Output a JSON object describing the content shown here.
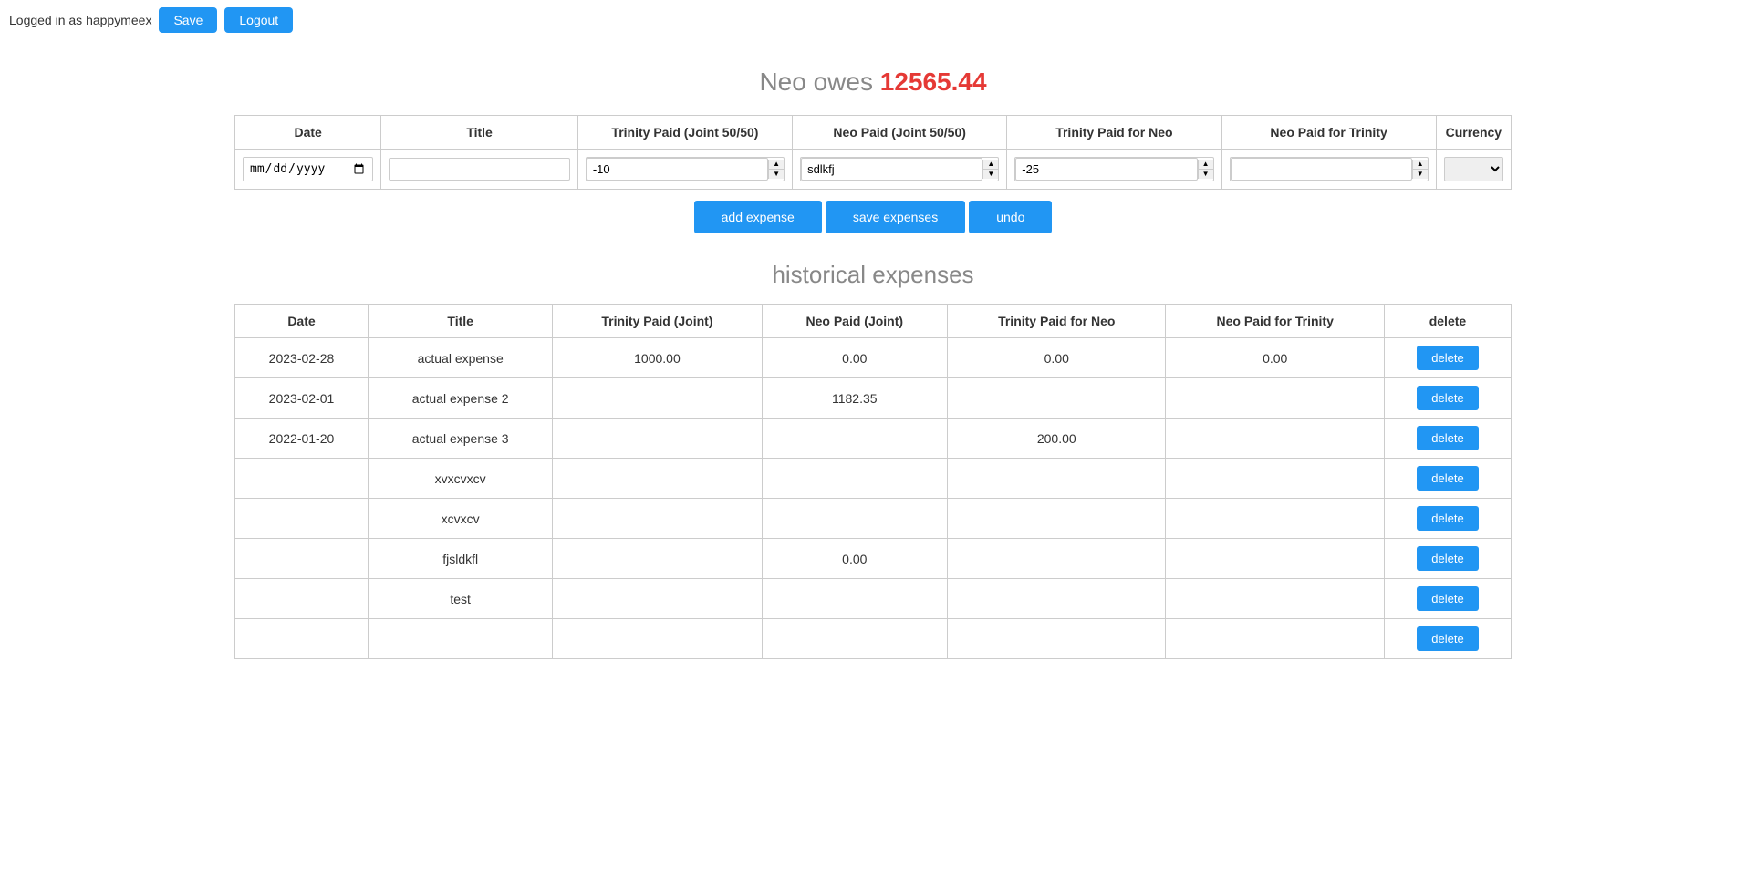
{
  "topbar": {
    "logged_in_text": "Logged in as happymeex",
    "save_label": "Save",
    "logout_label": "Logout"
  },
  "main_heading": {
    "text": "Neo owes",
    "amount": "12565.44"
  },
  "input_form": {
    "columns": [
      "Date",
      "Title",
      "Trinity Paid (Joint 50/50)",
      "Neo Paid (Joint 50/50)",
      "Trinity Paid for Neo",
      "Neo Paid for Trinity",
      "Currency"
    ],
    "date_placeholder": "mm / dd / yyyy",
    "title_value": "",
    "trinity_joint_value": "-10",
    "neo_joint_value": "sdlkfj",
    "trinity_for_neo_value": "-25",
    "neo_for_trinity_value": "",
    "currency_value": ""
  },
  "action_buttons": {
    "add_expense": "add expense",
    "save_expenses": "save expenses",
    "undo": "undo"
  },
  "historical_heading": "historical expenses",
  "history_table": {
    "columns": [
      "Date",
      "Title",
      "Trinity Paid (Joint)",
      "Neo Paid (Joint)",
      "Trinity Paid for Neo",
      "Neo Paid for Trinity",
      "delete"
    ],
    "rows": [
      {
        "date": "2023-02-28",
        "title": "actual expense",
        "trinity_joint": "1000.00",
        "neo_joint": "0.00",
        "trinity_for_neo": "0.00",
        "neo_for_trinity": "0.00"
      },
      {
        "date": "2023-02-01",
        "title": "actual expense 2",
        "trinity_joint": "",
        "neo_joint": "1182.35",
        "trinity_for_neo": "",
        "neo_for_trinity": ""
      },
      {
        "date": "2022-01-20",
        "title": "actual expense 3",
        "trinity_joint": "",
        "neo_joint": "",
        "trinity_for_neo": "200.00",
        "neo_for_trinity": ""
      },
      {
        "date": "",
        "title": "xvxcvxcv",
        "trinity_joint": "",
        "neo_joint": "",
        "trinity_for_neo": "",
        "neo_for_trinity": ""
      },
      {
        "date": "",
        "title": "xcvxcv",
        "trinity_joint": "",
        "neo_joint": "",
        "trinity_for_neo": "",
        "neo_for_trinity": ""
      },
      {
        "date": "",
        "title": "fjsldkfl",
        "trinity_joint": "",
        "neo_joint": "0.00",
        "trinity_for_neo": "",
        "neo_for_trinity": ""
      },
      {
        "date": "",
        "title": "test",
        "trinity_joint": "",
        "neo_joint": "",
        "trinity_for_neo": "",
        "neo_for_trinity": ""
      },
      {
        "date": "",
        "title": "",
        "trinity_joint": "",
        "neo_joint": "",
        "trinity_for_neo": "",
        "neo_for_trinity": ""
      }
    ],
    "delete_label": "delete"
  }
}
